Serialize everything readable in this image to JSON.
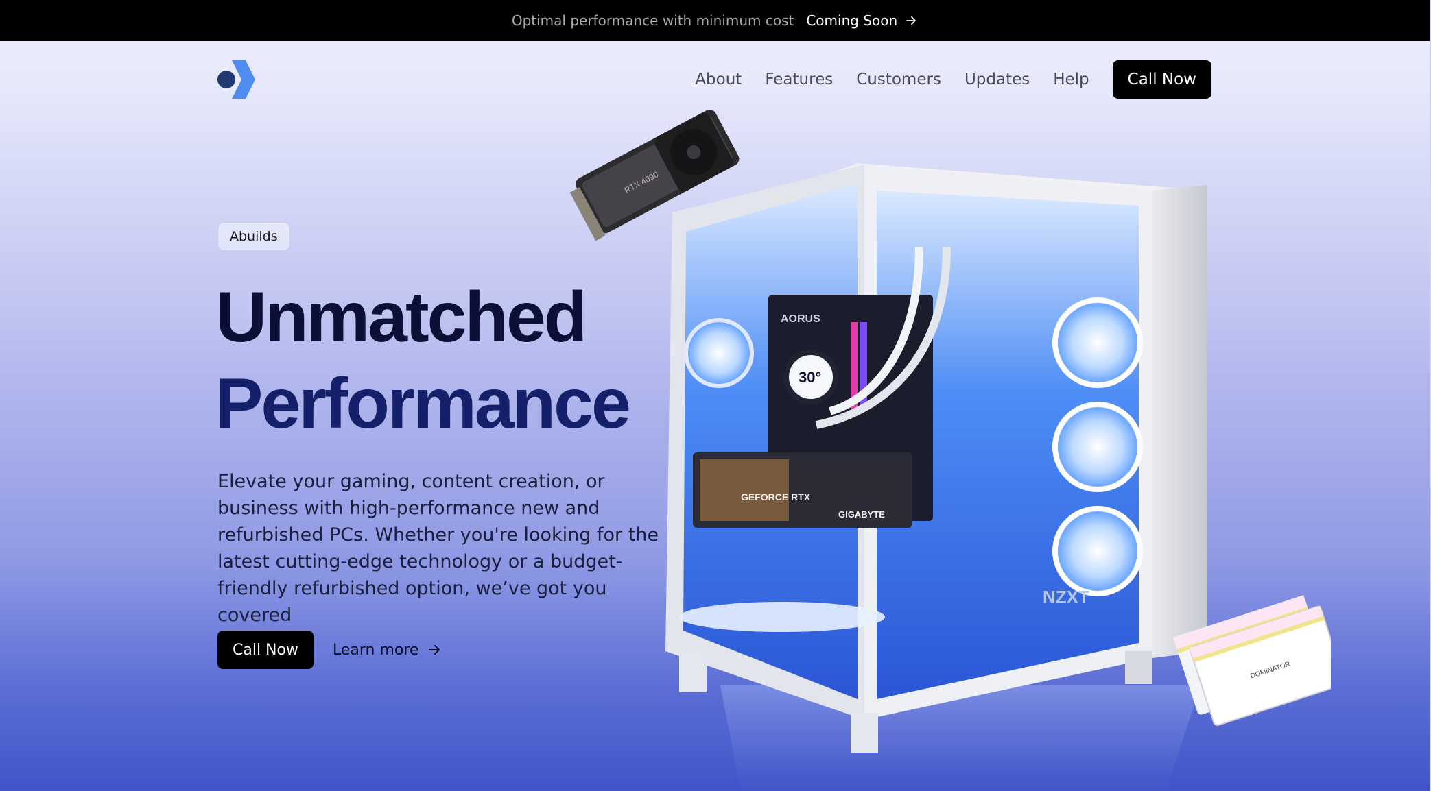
{
  "announcement": {
    "text": "Optimal performance with minimum cost",
    "link_label": "Coming Soon",
    "link_icon": "arrow-right-icon"
  },
  "brand": {
    "logo_icon": "chevron-logo-icon",
    "colors": {
      "dot": "#1f3a73",
      "chevron": "#4f8cf0"
    }
  },
  "nav": {
    "items": [
      "About",
      "Features",
      "Customers",
      "Updates",
      "Help"
    ],
    "cta_label": "Call Now"
  },
  "hero": {
    "badge": "Abuilds",
    "headline_line1": "Unmatched",
    "headline_line2": "Performance",
    "lede": "Elevate your gaming, content creation, or business with high-performance new and refurbished PCs. Whether you're looking for the latest cutting-edge technology or a budget-friendly refurbished option, we’ve got you covered",
    "primary_cta": "Call Now",
    "secondary_cta": "Learn more",
    "secondary_icon": "arrow-right-icon"
  },
  "product_images": {
    "gpu_label": "RTX 4090",
    "case_brand": "NZXT",
    "cooler_label": "30°",
    "gpu_brand": "GIGABYTE",
    "gpu_series": "GEFORCE RTX",
    "board_brand": "AORUS",
    "ram_brand": "DOMINATOR"
  },
  "colors": {
    "accent": "#000000",
    "headline": "#0c1036",
    "headline_accent": "#14206a",
    "glow": "#4aa8ff"
  }
}
